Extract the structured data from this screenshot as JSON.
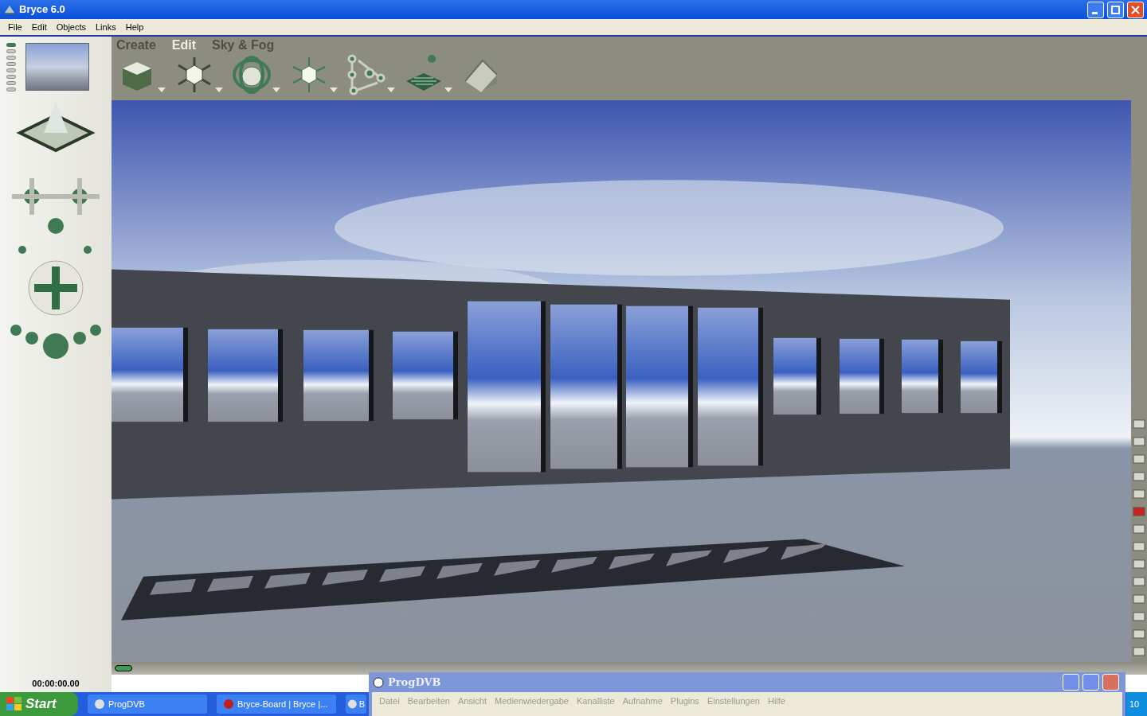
{
  "window": {
    "title": "Bryce 6.0"
  },
  "menu": [
    {
      "label": "File"
    },
    {
      "label": "Edit"
    },
    {
      "label": "Objects"
    },
    {
      "label": "Links"
    },
    {
      "label": "Help"
    }
  ],
  "palette_tabs": [
    {
      "label": "Create",
      "selected": false
    },
    {
      "label": "Edit",
      "selected": true
    },
    {
      "label": "Sky & Fog",
      "selected": false
    }
  ],
  "timeline": {
    "time": "00:00:00.00"
  },
  "progdvb": {
    "title": "ProgDVB",
    "menu": [
      {
        "label": "Datei"
      },
      {
        "label": "Bearbeiten"
      },
      {
        "label": "Ansicht"
      },
      {
        "label": "Medienwiedergabe"
      },
      {
        "label": "Kanalliste"
      },
      {
        "label": "Aufnahme"
      },
      {
        "label": "Plugins"
      },
      {
        "label": "Einstellungen"
      },
      {
        "label": "Hilfe"
      }
    ]
  },
  "taskbar": {
    "start": "Start",
    "tasks": [
      {
        "label": "ProgDVB"
      },
      {
        "label": "Bryce-Board | Bryce |..."
      },
      {
        "label": "B"
      }
    ],
    "clock": "10"
  }
}
